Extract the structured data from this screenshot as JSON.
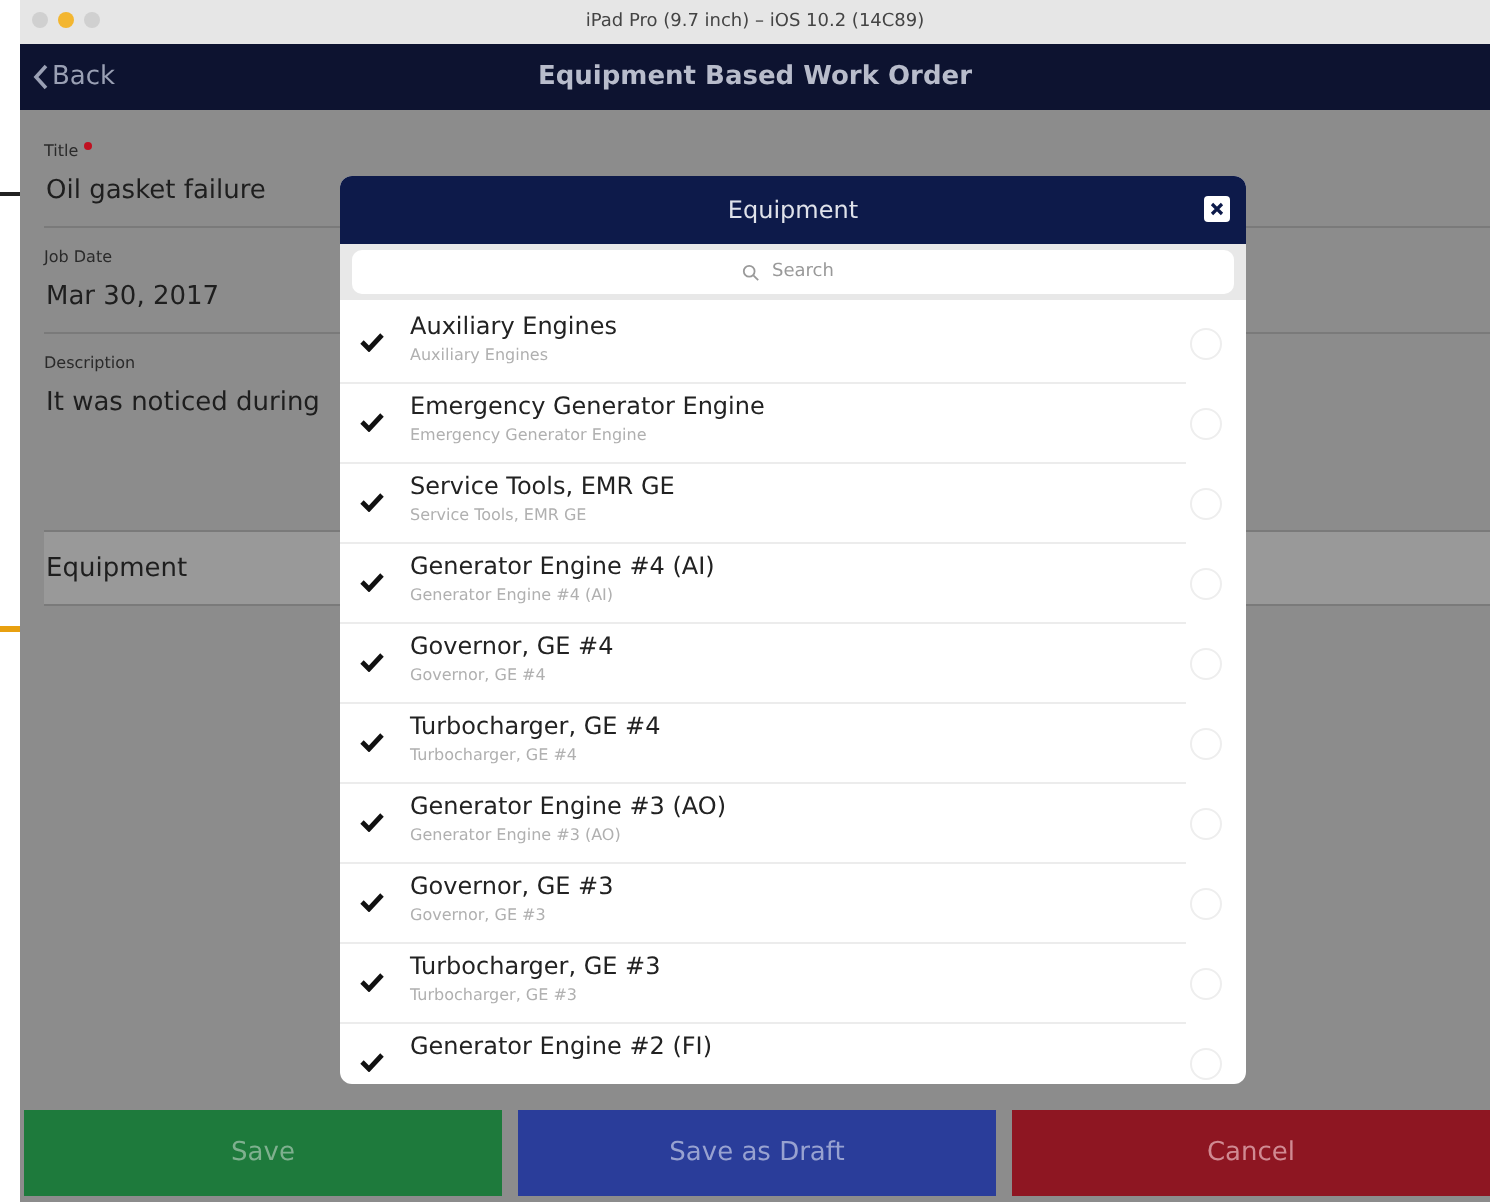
{
  "window": {
    "title": "iPad Pro (9.7 inch) – iOS 10.2 (14C89)"
  },
  "nav_bar": {
    "back": "Back",
    "title": "Equipment Based Work Order"
  },
  "form": {
    "fields": [
      {
        "kind": "text",
        "label": "Title",
        "required": true,
        "value": "Oil gasket failure"
      },
      {
        "kind": "text",
        "label": "Job Date",
        "required": false,
        "value": "Mar 30, 2017"
      },
      {
        "kind": "multiline",
        "label": "Description",
        "required": false,
        "value": "It was noticed during"
      },
      {
        "kind": "picker",
        "label": "Equipment"
      }
    ]
  },
  "dialog": {
    "title": "Equipment",
    "search": {
      "placeholder": "Search"
    },
    "items": [
      {
        "name": "Auxiliary Engines",
        "subtitle": "Auxiliary Engines",
        "checked": true
      },
      {
        "name": "Emergency Generator Engine",
        "subtitle": "Emergency Generator Engine",
        "checked": true
      },
      {
        "name": "Service Tools, EMR GE",
        "subtitle": "Service Tools, EMR GE",
        "checked": true
      },
      {
        "name": "Generator Engine #4 (AI)",
        "subtitle": "Generator Engine #4 (AI)",
        "checked": true
      },
      {
        "name": "Governor, GE #4",
        "subtitle": "Governor, GE #4",
        "checked": true
      },
      {
        "name": "Turbocharger, GE #4",
        "subtitle": "Turbocharger, GE #4",
        "checked": true
      },
      {
        "name": "Generator Engine #3 (AO)",
        "subtitle": "Generator Engine #3 (AO)",
        "checked": true
      },
      {
        "name": "Governor, GE #3",
        "subtitle": "Governor, GE #3",
        "checked": true
      },
      {
        "name": "Turbocharger, GE #3",
        "subtitle": "Turbocharger, GE #3",
        "checked": true
      },
      {
        "name": "Generator Engine #2 (FI)",
        "checked": true
      }
    ]
  },
  "buttons": [
    {
      "label": "Save",
      "kind": "save"
    },
    {
      "label": "Save as Draft",
      "kind": "draft"
    },
    {
      "label": "Cancel",
      "kind": "cancel"
    }
  ]
}
